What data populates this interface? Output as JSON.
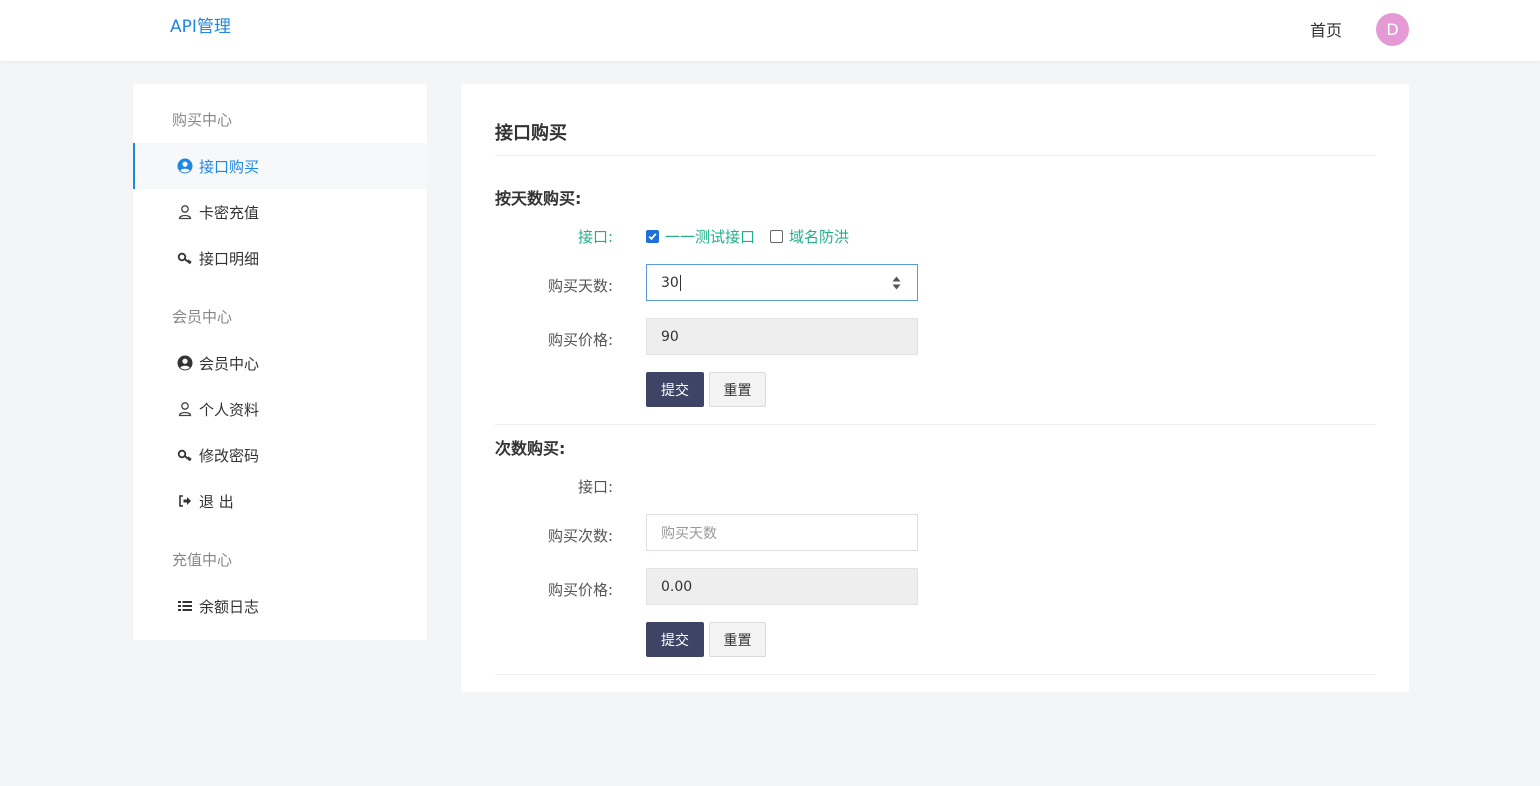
{
  "header": {
    "brand": "API管理",
    "home_link": "首页",
    "avatar_letter": "D"
  },
  "sidebar": {
    "sections": [
      {
        "title": "购买中心",
        "items": [
          {
            "label": "接口购买",
            "icon": "user-circle-icon",
            "active": true
          },
          {
            "label": "卡密充值",
            "icon": "user-outline-icon"
          },
          {
            "label": "接口明细",
            "icon": "key-icon"
          }
        ]
      },
      {
        "title": "会员中心",
        "items": [
          {
            "label": "会员中心",
            "icon": "user-circle-icon"
          },
          {
            "label": "个人资料",
            "icon": "user-outline-icon"
          },
          {
            "label": "修改密码",
            "icon": "key-icon"
          },
          {
            "label": "退 出",
            "icon": "sign-out-icon"
          }
        ]
      },
      {
        "title": "充值中心",
        "items": [
          {
            "label": "余额日志",
            "icon": "list-icon"
          }
        ]
      }
    ]
  },
  "main": {
    "title": "接口购买",
    "by_days": {
      "title": "按天数购买:",
      "api_label": "接口:",
      "options": [
        {
          "label": "一一测试接口",
          "checked": true
        },
        {
          "label": "域名防洪",
          "checked": false
        }
      ],
      "days_label": "购买天数:",
      "days_value": "30",
      "price_label": "购买价格:",
      "price_value": "90",
      "submit_label": "提交",
      "reset_label": "重置"
    },
    "by_count": {
      "title": "次数购买:",
      "api_label": "接口:",
      "count_label": "购买次数:",
      "count_placeholder": "购买天数",
      "price_label": "购买价格:",
      "price_value": "0.00",
      "submit_label": "提交",
      "reset_label": "重置"
    }
  },
  "colors": {
    "accent": "#1e88e5",
    "green": "#20b08a",
    "primary_button": "#3e4466",
    "avatar": "#e59ad6",
    "background": "#f4f5f7"
  }
}
